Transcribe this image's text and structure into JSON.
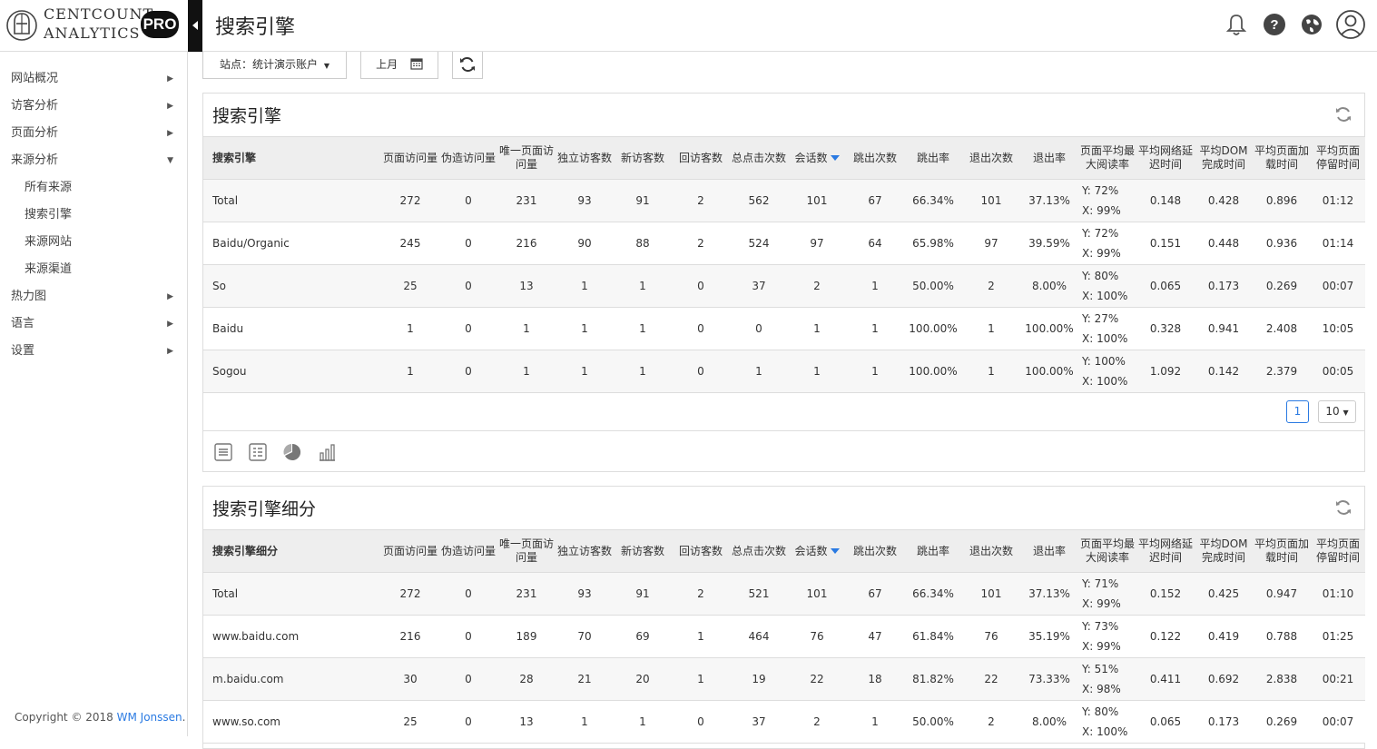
{
  "app": {
    "brand_line1": "CENTCOUNT",
    "brand_line2": "ANALYTICS",
    "pro_badge": "PRO",
    "page_title": "搜索引擎",
    "icons": [
      "bell-icon",
      "help-icon",
      "globe-icon",
      "user-icon"
    ]
  },
  "sidebar": {
    "items": [
      {
        "label": "网站概况",
        "arrow": "▶"
      },
      {
        "label": "访客分析",
        "arrow": "▶"
      },
      {
        "label": "页面分析",
        "arrow": "▶"
      },
      {
        "label": "来源分析",
        "arrow": "▼"
      },
      {
        "label": "所有来源",
        "arrow": ""
      },
      {
        "label": "搜索引擎",
        "arrow": ""
      },
      {
        "label": "来源网站",
        "arrow": ""
      },
      {
        "label": "来源渠道",
        "arrow": ""
      },
      {
        "label": "热力图",
        "arrow": "▶"
      },
      {
        "label": "语言",
        "arrow": "▶"
      },
      {
        "label": "设置",
        "arrow": "▶"
      }
    ],
    "copyright_prefix": "Copyright © 2018 ",
    "copyright_link": "WM Jonssen",
    "copyright_suffix": "."
  },
  "toolbar": {
    "site_select": "站点：统计演示账户",
    "date_label": "上月"
  },
  "columns": [
    "页面访问量",
    "伪造访问量",
    "唯一页面访问量",
    "独立访客数",
    "新访客数",
    "回访客数",
    "总点击次数",
    "会话数",
    "跳出次数",
    "跳出率",
    "退出次数",
    "退出率",
    "页面平均最大阅读率",
    "平均网络延迟时间",
    "平均DOM完成时间",
    "平均页面加载时间",
    "平均页面停留时间"
  ],
  "panel1": {
    "title": "搜索引擎",
    "first_col": "搜索引擎",
    "rows": [
      {
        "name": "Total",
        "c": [
          "272",
          "0",
          "231",
          "93",
          "91",
          "2",
          "562",
          "101",
          "67",
          "66.34%",
          "101",
          "37.13%"
        ],
        "y": "Y: 72%",
        "x": "X: 99%",
        "t": [
          "0.148",
          "0.428",
          "0.896",
          "01:12"
        ]
      },
      {
        "name": "Baidu/Organic",
        "c": [
          "245",
          "0",
          "216",
          "90",
          "88",
          "2",
          "524",
          "97",
          "64",
          "65.98%",
          "97",
          "39.59%"
        ],
        "y": "Y: 72%",
        "x": "X: 99%",
        "t": [
          "0.151",
          "0.448",
          "0.936",
          "01:14"
        ]
      },
      {
        "name": "So",
        "c": [
          "25",
          "0",
          "13",
          "1",
          "1",
          "0",
          "37",
          "2",
          "1",
          "50.00%",
          "2",
          "8.00%"
        ],
        "y": "Y: 80%",
        "x": "X: 100%",
        "t": [
          "0.065",
          "0.173",
          "0.269",
          "00:07"
        ]
      },
      {
        "name": "Baidu",
        "c": [
          "1",
          "0",
          "1",
          "1",
          "1",
          "0",
          "0",
          "1",
          "1",
          "100.00%",
          "1",
          "100.00%"
        ],
        "y": "Y: 27%",
        "x": "X: 100%",
        "t": [
          "0.328",
          "0.941",
          "2.408",
          "10:05"
        ]
      },
      {
        "name": "Sogou",
        "c": [
          "1",
          "0",
          "1",
          "1",
          "1",
          "0",
          "1",
          "1",
          "1",
          "100.00%",
          "1",
          "100.00%"
        ],
        "y": "Y: 100%",
        "x": "X: 100%",
        "t": [
          "1.092",
          "0.142",
          "2.379",
          "00:05"
        ]
      }
    ],
    "page_current": "1",
    "page_size": "10"
  },
  "panel2": {
    "title": "搜索引擎细分",
    "first_col": "搜索引擎细分",
    "rows": [
      {
        "name": "Total",
        "c": [
          "272",
          "0",
          "231",
          "93",
          "91",
          "2",
          "521",
          "101",
          "67",
          "66.34%",
          "101",
          "37.13%"
        ],
        "y": "Y: 71%",
        "x": "X: 99%",
        "t": [
          "0.152",
          "0.425",
          "0.947",
          "01:10"
        ]
      },
      {
        "name": "www.baidu.com",
        "c": [
          "216",
          "0",
          "189",
          "70",
          "69",
          "1",
          "464",
          "76",
          "47",
          "61.84%",
          "76",
          "35.19%"
        ],
        "y": "Y: 73%",
        "x": "X: 99%",
        "t": [
          "0.122",
          "0.419",
          "0.788",
          "01:25"
        ]
      },
      {
        "name": "m.baidu.com",
        "c": [
          "30",
          "0",
          "28",
          "21",
          "20",
          "1",
          "19",
          "22",
          "18",
          "81.82%",
          "22",
          "73.33%"
        ],
        "y": "Y: 51%",
        "x": "X: 98%",
        "t": [
          "0.411",
          "0.692",
          "2.838",
          "00:21"
        ]
      },
      {
        "name": "www.so.com",
        "c": [
          "25",
          "0",
          "13",
          "1",
          "1",
          "0",
          "37",
          "2",
          "1",
          "50.00%",
          "2",
          "8.00%"
        ],
        "y": "Y: 80%",
        "x": "X: 100%",
        "t": [
          "0.065",
          "0.173",
          "0.269",
          "00:07"
        ]
      }
    ]
  },
  "colors": {
    "accent": "#2a7ae2",
    "header_bg": "#eeeeee",
    "dark": "#111111"
  }
}
